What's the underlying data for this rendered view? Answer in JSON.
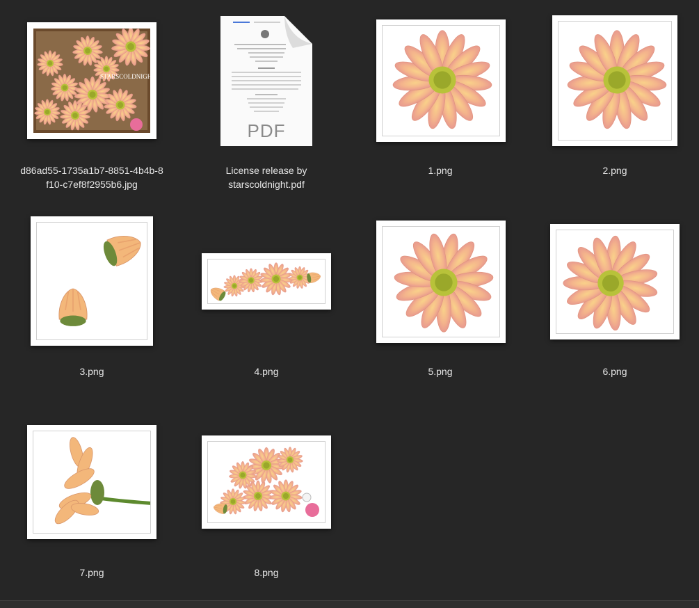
{
  "files": [
    {
      "name_line1": "d86ad55-1735a1b7-8851-4b4b-8",
      "name_line2": "f10-c7ef8f2955b6.jpg",
      "thumb": "flower-collage-photo",
      "watermark": "STARSCOLDNIGHT"
    },
    {
      "name_line1": "License release by",
      "name_line2": "starscoldnight.pdf",
      "thumb": "pdf-document-icon",
      "badge": "PDF"
    },
    {
      "name_line1": "1.png",
      "name_line2": "",
      "thumb": "peach-daisy-flower"
    },
    {
      "name_line1": "2.png",
      "name_line2": "",
      "thumb": "peach-daisy-flower"
    },
    {
      "name_line1": "3.png",
      "name_line2": "",
      "thumb": "two-flower-buds"
    },
    {
      "name_line1": "4.png",
      "name_line2": "",
      "thumb": "flower-garland-strip"
    },
    {
      "name_line1": "5.png",
      "name_line2": "",
      "thumb": "curled-petal-flower"
    },
    {
      "name_line1": "6.png",
      "name_line2": "",
      "thumb": "peach-daisy-flower"
    },
    {
      "name_line1": "7.png",
      "name_line2": "",
      "thumb": "side-view-flower-with-stem"
    },
    {
      "name_line1": "8.png",
      "name_line2": "",
      "thumb": "flower-bouquet-pile"
    }
  ],
  "colors": {
    "background": "#262626",
    "label": "#e6e6e6",
    "petal": "#f4b48c",
    "center": "#b8c23a"
  }
}
